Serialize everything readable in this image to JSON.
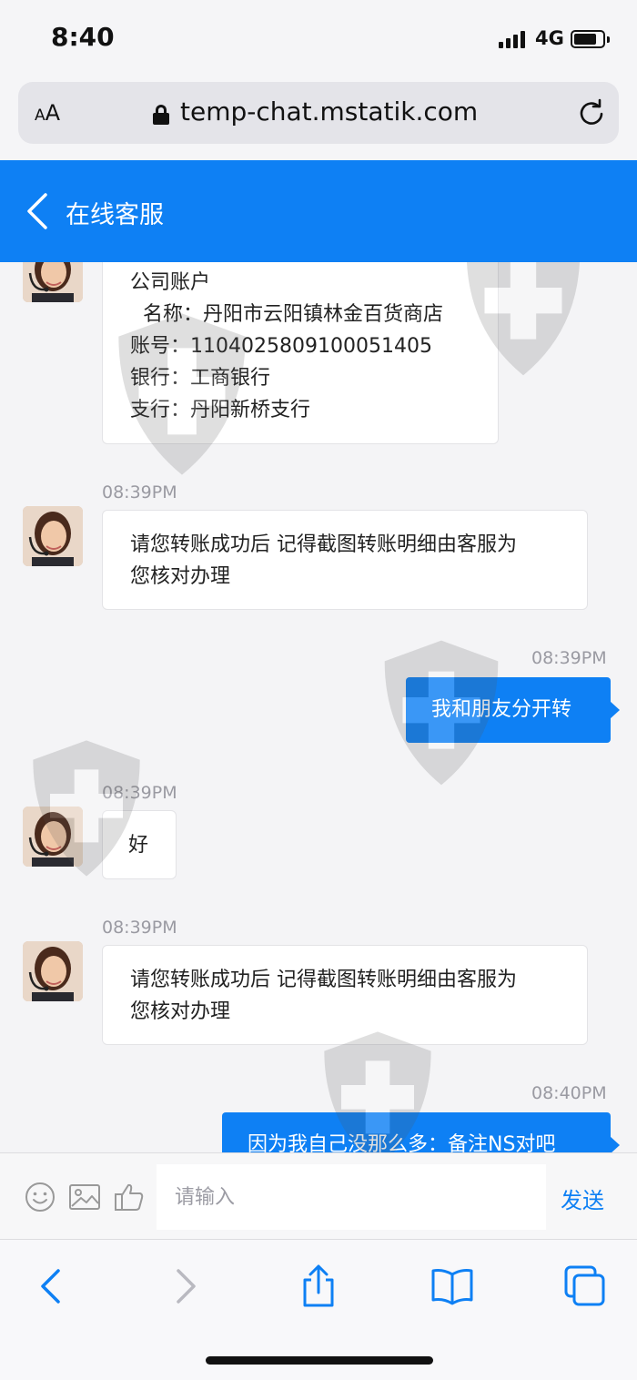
{
  "status_bar": {
    "time": "8:40",
    "network": "4G"
  },
  "browser": {
    "aa_small": "A",
    "aa_large": "A",
    "url": "temp-chat.mstatik.com"
  },
  "header": {
    "title": "在线客服"
  },
  "messages": [
    {
      "lines": [
        "公司账户",
        "名称：丹阳市云阳镇林金百货商店",
        "账号：1104025809100051405",
        "银行：工商银行",
        "支行：丹阳新桥支行"
      ]
    },
    {
      "time": "08:39PM",
      "lines": [
        "请您转账成功后 记得截图转账明细由客服为",
        "您核对办理"
      ]
    },
    {
      "time": "08:39PM",
      "text": "我和朋友分开转"
    },
    {
      "time": "08:39PM",
      "lines": [
        "好"
      ]
    },
    {
      "time": "08:39PM",
      "lines": [
        "请您转账成功后 记得截图转账明细由客服为",
        "您核对办理"
      ]
    },
    {
      "time": "08:40PM",
      "text": "因为我自己没那么多：备注NS对吧"
    }
  ],
  "input": {
    "placeholder": "请输入",
    "send_label": "发送"
  },
  "colors": {
    "accent": "#0e80f4",
    "background": "#f4f4f6"
  }
}
